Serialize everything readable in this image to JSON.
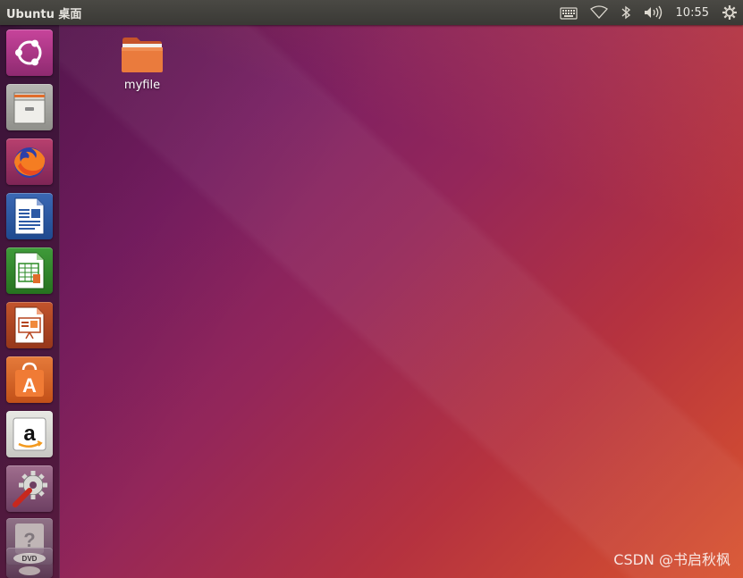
{
  "topbar": {
    "app_title": "Ubuntu 桌面",
    "indicators": {
      "keyboard_icon": "keyboard-icon",
      "wifi_icon": "wifi-icon",
      "bluetooth_icon": "bluetooth-icon",
      "volume_icon": "volume-icon",
      "clock": "10:55",
      "settings_icon": "gear-icon"
    }
  },
  "launcher": {
    "items": [
      {
        "icon": "ubuntu-dash-icon"
      },
      {
        "icon": "files-icon"
      },
      {
        "icon": "firefox-icon"
      },
      {
        "icon": "libreoffice-writer-icon"
      },
      {
        "icon": "libreoffice-calc-icon"
      },
      {
        "icon": "libreoffice-impress-icon"
      },
      {
        "icon": "software-center-icon"
      },
      {
        "icon": "amazon-icon"
      },
      {
        "icon": "system-settings-icon"
      },
      {
        "icon": "help-icon"
      },
      {
        "icon": "dvd-icon"
      }
    ]
  },
  "desktop": {
    "icons": [
      {
        "label": "myfile",
        "icon": "folder-icon"
      }
    ]
  },
  "watermark": "CSDN @书启秋枫",
  "colors": {
    "topbar": "#3c3b37",
    "wallpaper_start": "#5a1a55",
    "wallpaper_end": "#d9532e",
    "folder": "#e9783e"
  }
}
